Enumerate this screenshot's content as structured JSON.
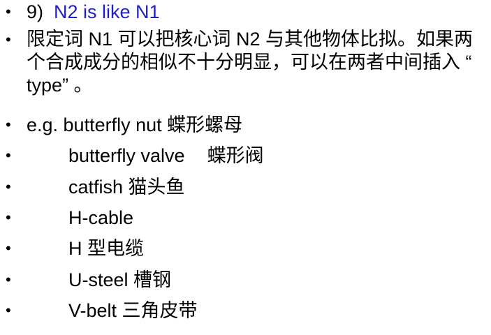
{
  "items": [
    {
      "num": "9)",
      "heading": "N2 is like N1"
    },
    {
      "text": "限定词 N1 可以把核心词 N2 与其他物体比拟。如果两个合成成分的相似不十分明显，可以在两者中间插入 “ type” 。"
    },
    {
      "text": "e.g. butterfly nut 蝶形螺母"
    },
    {
      "term": "butterfly valve",
      "gloss": "蝶形阀"
    },
    {
      "text": "catfish 猫头鱼"
    },
    {
      "text": "H-cable"
    },
    {
      "text": "H 型电缆"
    },
    {
      "text": "U-steel 槽钢"
    },
    {
      "text": "V-belt 三角皮带"
    }
  ],
  "bullet_symbol": "•",
  "colors": {
    "heading": "#1f1fc8",
    "text": "#000000",
    "background": "#ffffff"
  }
}
